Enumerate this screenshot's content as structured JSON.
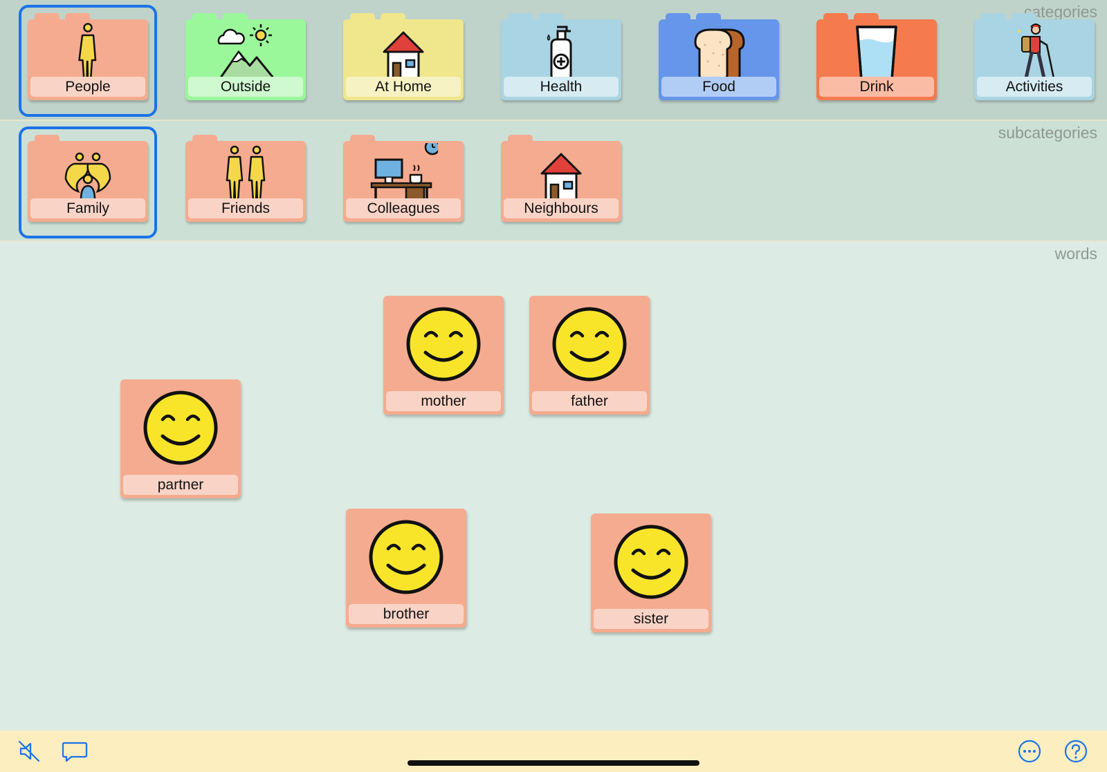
{
  "categories": {
    "section_label": "categories",
    "items": [
      {
        "label": "People",
        "icon": "person-icon",
        "color": "#f5ab8f",
        "label_bg": "#f9d4c6",
        "selected": true
      },
      {
        "label": "Outside",
        "icon": "outdoors-icon",
        "color": "#9af79a",
        "label_bg": "#cff9cf",
        "selected": false
      },
      {
        "label": "At Home",
        "icon": "house-icon",
        "color": "#f0e68c",
        "label_bg": "#f7f2c4",
        "selected": false
      },
      {
        "label": "Health",
        "icon": "soap-bottle-icon",
        "color": "#a9d4e3",
        "label_bg": "#d6ebf2",
        "selected": false
      },
      {
        "label": "Food",
        "icon": "bread-icon",
        "color": "#6596e9",
        "label_bg": "#b2cdf5",
        "selected": false
      },
      {
        "label": "Drink",
        "icon": "glass-of-water-icon",
        "color": "#f57a4e",
        "label_bg": "#fbbca5",
        "selected": false
      },
      {
        "label": "Activities",
        "icon": "hiker-icon",
        "color": "#a9d4e3",
        "label_bg": "#d6ebf2",
        "selected": false
      }
    ]
  },
  "subcategories": {
    "section_label": "subcategories",
    "items": [
      {
        "label": "Family",
        "icon": "family-icon",
        "selected": true
      },
      {
        "label": "Friends",
        "icon": "friends-icon",
        "selected": false
      },
      {
        "label": "Colleagues",
        "icon": "office-desk-icon",
        "selected": false
      },
      {
        "label": "Neighbours",
        "icon": "house-icon",
        "selected": false
      }
    ]
  },
  "words": {
    "section_label": "words",
    "items": [
      {
        "label": "mother",
        "icon": "smiley-face-icon"
      },
      {
        "label": "father",
        "icon": "smiley-face-icon"
      },
      {
        "label": "partner",
        "icon": "smiley-face-icon"
      },
      {
        "label": "brother",
        "icon": "smiley-face-icon"
      },
      {
        "label": "sister",
        "icon": "smiley-face-icon"
      }
    ]
  },
  "toolbar": {
    "left_icons": [
      "speaker-muted-icon",
      "speech-bubble-icon"
    ],
    "right_icons": [
      "more-options-icon",
      "help-icon"
    ],
    "accent_color": "#1a73e8"
  }
}
